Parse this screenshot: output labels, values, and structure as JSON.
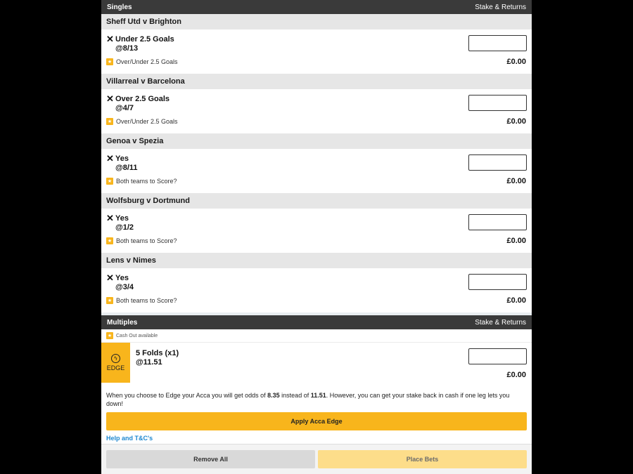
{
  "singles_header": {
    "title": "Singles",
    "right": "Stake & Returns"
  },
  "events": [
    {
      "name": "Sheff Utd v Brighton",
      "selection": "Under 2.5 Goals",
      "odds": "@8/13",
      "market": "Over/Under 2.5 Goals",
      "returns": "£0.00"
    },
    {
      "name": "Villarreal v Barcelona",
      "selection": "Over 2.5 Goals",
      "odds": "@4/7",
      "market": "Over/Under 2.5 Goals",
      "returns": "£0.00"
    },
    {
      "name": "Genoa v Spezia",
      "selection": "Yes",
      "odds": "@8/11",
      "market": "Both teams to Score?",
      "returns": "£0.00"
    },
    {
      "name": "Wolfsburg v Dortmund",
      "selection": "Yes",
      "odds": "@1/2",
      "market": "Both teams to Score?",
      "returns": "£0.00"
    },
    {
      "name": "Lens v Nimes",
      "selection": "Yes",
      "odds": "@3/4",
      "market": "Both teams to Score?",
      "returns": "£0.00"
    }
  ],
  "multiples_header": {
    "title": "Multiples",
    "right": "Stake & Returns"
  },
  "multiples": {
    "cashout": "Cash Out available",
    "edge_label": "EDGE",
    "fold_title": "5 Folds (x1)",
    "fold_odds": "@11.51",
    "returns": "£0.00",
    "info_pre": "When you choose to Edge your Acca you will get odds of ",
    "info_odds_new": "8.35",
    "info_mid": " instead of ",
    "info_odds_old": "11.51",
    "info_post": ". However, you can get your stake back in cash if one leg lets you down!",
    "apply_label": "Apply Acca Edge",
    "help_link": "Help and T&C's"
  },
  "footer": {
    "remove_all": "Remove All",
    "place_bets": "Place Bets"
  },
  "icons": {
    "remove": "close-icon",
    "badge": "star-icon",
    "edge": "lightning-icon"
  },
  "colors": {
    "accent": "#f8b51c",
    "header_bg": "#3a3a3a",
    "link": "#1e88d0"
  }
}
